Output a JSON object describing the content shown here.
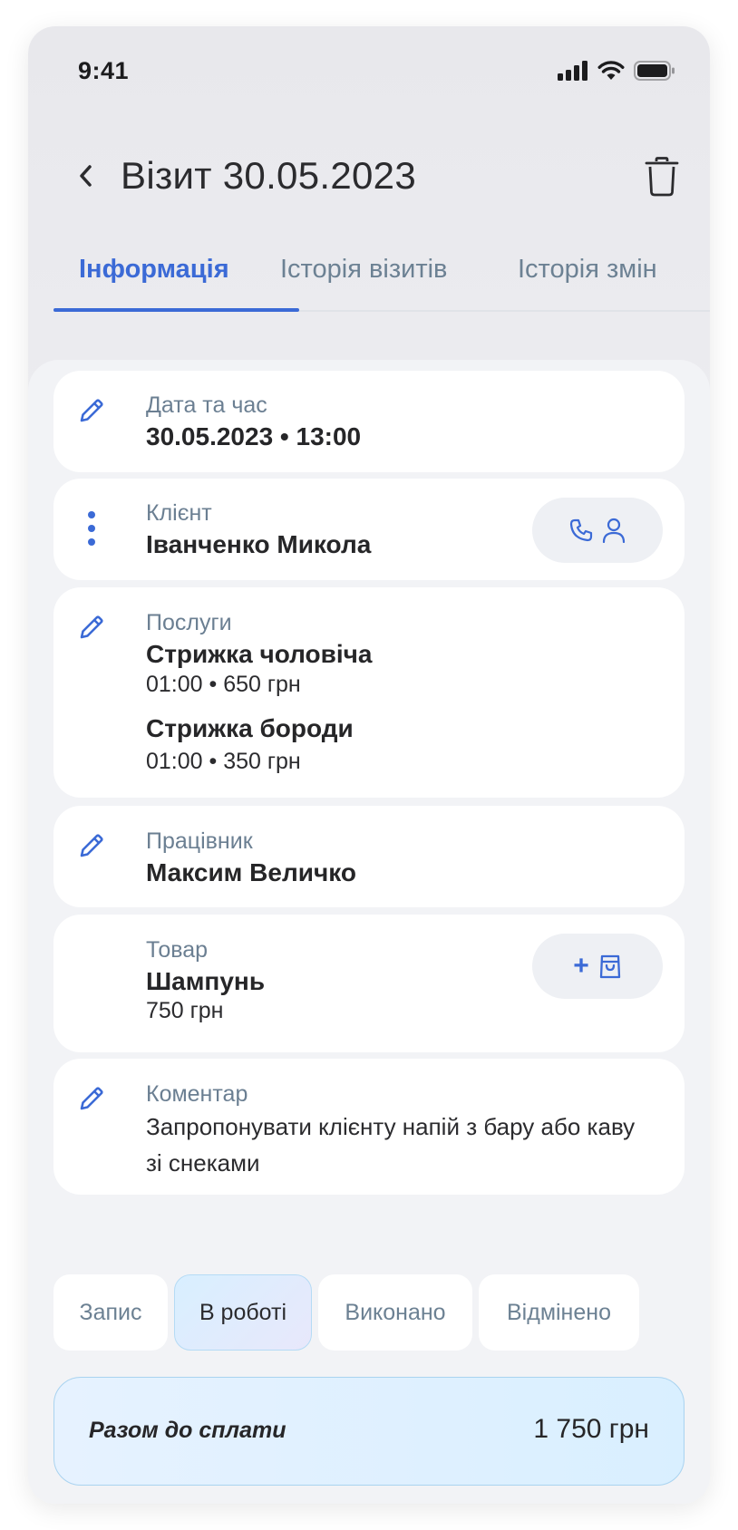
{
  "status_bar": {
    "time": "9:41"
  },
  "header": {
    "title": "Візит 30.05.2023"
  },
  "tabs": [
    {
      "label": "Інформація",
      "active": true
    },
    {
      "label": "Історія візитів",
      "active": false
    },
    {
      "label": "Історія змін",
      "active": false
    }
  ],
  "cards": {
    "datetime": {
      "label": "Дата та час",
      "value": "30.05.2023 • 13:00"
    },
    "client": {
      "label": "Клієнт",
      "value": "Іванченко Микола"
    },
    "services": {
      "label": "Послуги",
      "items": [
        {
          "name": "Стрижка чоловіча",
          "details": "01:00 • 650 грн"
        },
        {
          "name": "Стрижка бороди",
          "details": "01:00 • 350 грн"
        }
      ]
    },
    "employee": {
      "label": "Працівник",
      "value": "Максим Величко"
    },
    "product": {
      "label": "Товар",
      "value": "Шампунь",
      "price": "750 грн",
      "add_symbol": "+"
    },
    "comment": {
      "label": "Коментар",
      "text": "Запропонувати клієнту напій з бару або каву зі снеками"
    }
  },
  "statuses": [
    {
      "label": "Запис",
      "active": false
    },
    {
      "label": "В роботі",
      "active": true
    },
    {
      "label": "Виконано",
      "active": false
    },
    {
      "label": "Відмінено",
      "active": false
    }
  ],
  "total": {
    "label": "Разом до сплати",
    "value": "1 750 грн"
  },
  "colors": {
    "accent": "#3b6ad6",
    "label": "#6b7f92",
    "text": "#262628"
  },
  "icons": [
    "back-chevron-icon",
    "trash-icon",
    "pencil-icon",
    "kebab-icon",
    "phone-icon",
    "user-icon",
    "bag-icon"
  ]
}
